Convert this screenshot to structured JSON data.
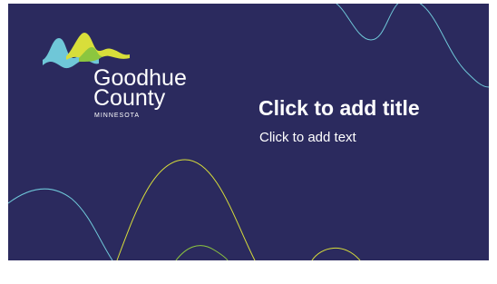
{
  "slide": {
    "background_color": "#2b2a5e",
    "title_placeholder": "Click to add title",
    "text_placeholder": "Click to add text"
  },
  "logo": {
    "line1": "Goodhue",
    "line2": "County",
    "line3": "MINNESOTA",
    "colors": {
      "teal": "#6fc7d8",
      "lime": "#d8de3a",
      "green": "#8cc63f",
      "text": "#ffffff"
    }
  },
  "decorative_waves": {
    "colors": [
      "#6fc7d8",
      "#d8de3a",
      "#8cc63f"
    ]
  }
}
